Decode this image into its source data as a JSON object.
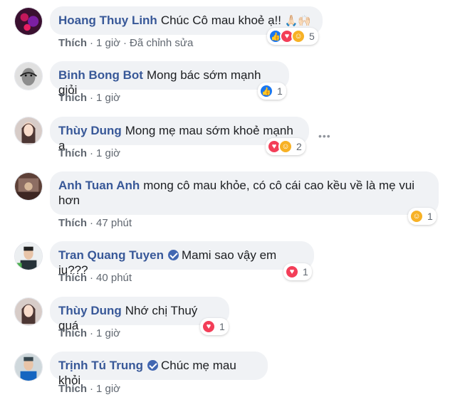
{
  "colors": {
    "author": "#385898",
    "bubble": "#f0f2f5",
    "meta": "#606770",
    "like": "#1877f2",
    "love": "#f33e58",
    "care": "#f7b125"
  },
  "comments": [
    {
      "author": "Hoang Thuy Linh",
      "text": "Chúc Cô mau khoẻ ạ!!",
      "emoji": "🙏🏻🙌🏻",
      "like": "Thích",
      "time": "1 giờ",
      "edited": "Đã chỉnh sửa",
      "reactions": [
        "like",
        "love",
        "care"
      ],
      "count": "5"
    },
    {
      "author": "Binh Bong Bot",
      "text": "Mong bác sớm mạnh giỏi",
      "like": "Thích",
      "time": "1 giờ",
      "reactions": [
        "like"
      ],
      "count": "1"
    },
    {
      "author": "Thùy Dung",
      "text": "Mong mẹ mau sớm khoẻ mạnh ạ",
      "like": "Thích",
      "time": "1 giờ",
      "reactions": [
        "love",
        "care"
      ],
      "count": "2",
      "more": "•••"
    },
    {
      "author": "Anh Tuan Anh",
      "text": "mong cô mau khỏe, có cô cái cao kều về là mẹ vui hơn",
      "like": "Thích",
      "time": "47 phút",
      "reactions": [
        "care"
      ],
      "count": "1"
    },
    {
      "author": "Tran Quang Tuyen",
      "text": "Mami sao vậy em iu???",
      "like": "Thích",
      "time": "40 phút",
      "reactions": [
        "love"
      ],
      "count": "1",
      "verified": true
    },
    {
      "author": "Thùy Dung",
      "text": "Nhớ chị Thuý quá",
      "like": "Thích",
      "time": "1 giờ",
      "reactions": [
        "love"
      ],
      "count": "1"
    },
    {
      "author": "Trịnh Tú Trung",
      "text": "Chúc mẹ mau khỏi",
      "like": "Thích",
      "time": "1 giờ",
      "verified": true
    }
  ]
}
